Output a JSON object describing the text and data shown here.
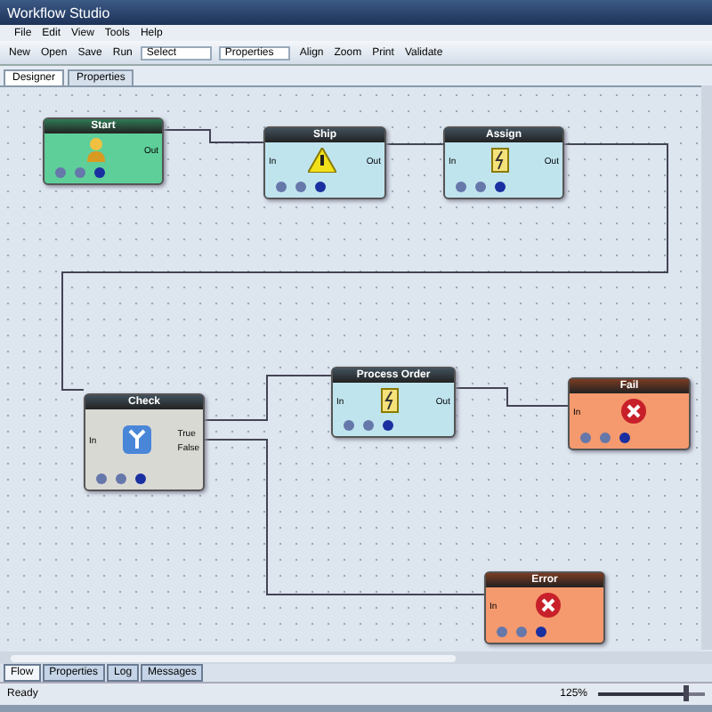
{
  "window": {
    "title": "Workflow Studio"
  },
  "menu": [
    "File",
    "Edit",
    "View",
    "Tools",
    "Help"
  ],
  "toolbar": [
    {
      "label": "New",
      "kind": "button"
    },
    {
      "label": "Open",
      "kind": "button"
    },
    {
      "label": "Save",
      "kind": "button"
    },
    {
      "label": "Run",
      "kind": "button"
    },
    {
      "label": "Select",
      "kind": "combo"
    },
    {
      "label": "Properties",
      "kind": "combo"
    },
    {
      "label": "Align",
      "kind": "button"
    },
    {
      "label": "Zoom",
      "kind": "button"
    },
    {
      "label": "Print",
      "kind": "button"
    },
    {
      "label": "Validate",
      "kind": "button"
    }
  ],
  "doc_tabs": [
    {
      "label": "Designer",
      "selected": true
    },
    {
      "label": "Properties",
      "selected": false
    }
  ],
  "nodes": [
    {
      "title": "Start",
      "kind": "start",
      "outputs": [
        "Out"
      ]
    },
    {
      "title": "Ship",
      "kind": "warning",
      "inputs": [
        "In"
      ],
      "outputs": [
        "Out"
      ]
    },
    {
      "title": "Assign",
      "kind": "action",
      "inputs": [
        "In"
      ],
      "outputs": [
        "Out"
      ]
    },
    {
      "title": "Check",
      "kind": "decision",
      "inputs": [
        "In"
      ],
      "outputs": [
        "True",
        "False"
      ]
    },
    {
      "title": "Process Order",
      "kind": "action",
      "inputs": [
        "In"
      ],
      "outputs": [
        "Out"
      ]
    },
    {
      "title": "Fail",
      "kind": "error",
      "inputs": [
        "In"
      ]
    },
    {
      "title": "Error",
      "kind": "error",
      "inputs": [
        "In"
      ]
    }
  ],
  "bottom_tabs": [
    {
      "label": "Flow",
      "selected": true
    },
    {
      "label": "Properties",
      "selected": false
    },
    {
      "label": "Log",
      "selected": false
    },
    {
      "label": "Messages",
      "selected": false
    }
  ],
  "status_bar": {
    "text": "Ready",
    "zoom": "125%",
    "zoom_slider": {
      "level": 0.82
    }
  }
}
